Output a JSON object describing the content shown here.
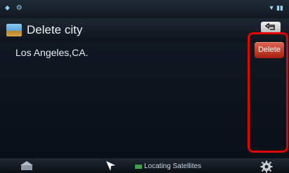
{
  "header": {
    "title": "Delete city"
  },
  "cities": [
    {
      "name": "Los Angeles,CA."
    }
  ],
  "buttons": {
    "delete_label": "Delete"
  },
  "bottom_bar": {
    "status_text": "Locating Satellites"
  },
  "icons": [
    "photo-icon",
    "back-icon",
    "navigation-icon",
    "sat-icon",
    "settings-icon"
  ],
  "colors": {
    "accent_red": "#e20000",
    "delete_red": "#c0392b"
  }
}
